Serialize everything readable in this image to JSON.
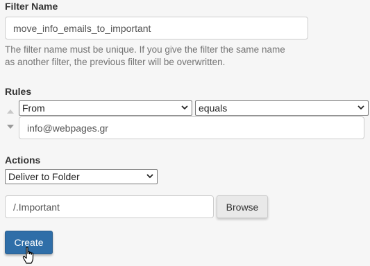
{
  "filter_name": {
    "label": "Filter Name",
    "value": "move_info_emails_to_important",
    "help": "The filter name must be unique. If you give the filter the same name as another filter, the previous filter will be overwritten."
  },
  "rules": {
    "label": "Rules",
    "field_select": "From",
    "operator_select": "equals",
    "value": "info@webpages.gr"
  },
  "actions": {
    "label": "Actions",
    "action_select": "Deliver to Folder",
    "folder_value": "/.Important",
    "browse_label": "Browse"
  },
  "create_label": "Create",
  "colors": {
    "background": "#f6f6f6",
    "primary_button": "#2f6ea8",
    "help_text": "#737373"
  }
}
